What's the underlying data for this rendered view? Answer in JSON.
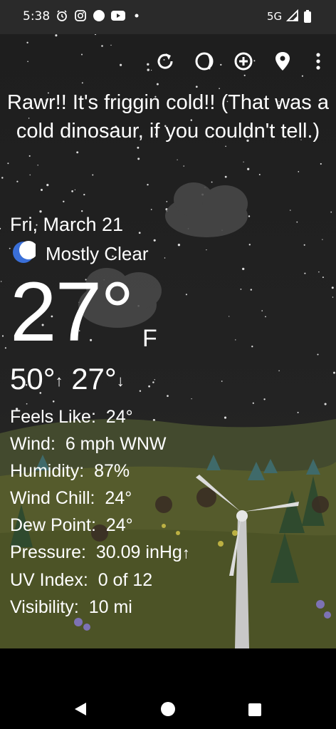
{
  "status_bar": {
    "time": "5:38",
    "network": "5G",
    "icons": [
      "alarm-icon",
      "instagram-icon",
      "dot-icon",
      "youtube-icon",
      "small-dot-icon",
      "signal-icon",
      "battery-icon"
    ]
  },
  "toolbar": {
    "buttons": [
      "refresh-icon",
      "moon-phase-icon",
      "add-location-icon",
      "location-pin-icon",
      "more-vert-icon"
    ]
  },
  "message": "Rawr!! It's friggin cold!! (That was a cold dinosaur, if you couldn't tell.)",
  "weather": {
    "date": "Fri, March 21",
    "condition_icon": "crescent-moon-icon",
    "condition": "Mostly Clear",
    "temperature": "27°",
    "unit": "F",
    "high": "50°",
    "low": "27°"
  },
  "details": [
    {
      "label": "Feels Like:",
      "value": "24°",
      "arrow": ""
    },
    {
      "label": "Wind:",
      "value": "6 mph WNW",
      "arrow": ""
    },
    {
      "label": "Humidity:",
      "value": "87%",
      "arrow": ""
    },
    {
      "label": "Wind Chill:",
      "value": "24°",
      "arrow": ""
    },
    {
      "label": "Dew Point:",
      "value": "24°",
      "arrow": ""
    },
    {
      "label": "Pressure:",
      "value": "30.09 inHg",
      "arrow": "↑"
    },
    {
      "label": "UV Index:",
      "value": "0 of 12",
      "arrow": ""
    },
    {
      "label": "Visibility:",
      "value": "10 mi",
      "arrow": ""
    }
  ],
  "colors": {
    "status_bar": "#2a2a2a",
    "moon": "#3a6fd8",
    "hill": "#5a6a2a"
  }
}
